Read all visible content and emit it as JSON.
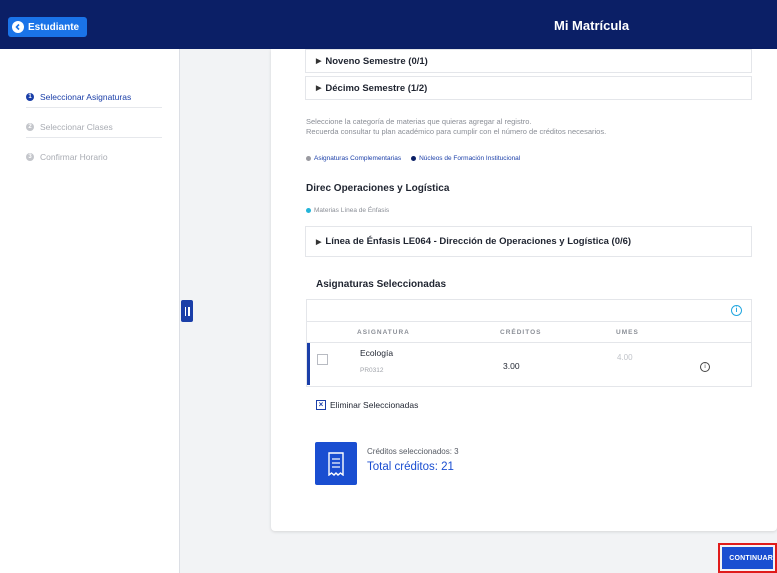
{
  "header": {
    "back_label": "Estudiante",
    "title": "Mi Matrícula",
    "bar_color": "#0b1f66"
  },
  "sidebar": {
    "steps": [
      {
        "label": "Seleccionar Asignaturas",
        "number": "1",
        "state": "active"
      },
      {
        "label": "Seleccionar Clases",
        "number": "2",
        "state": "inactive"
      },
      {
        "label": "Confirmar Horario",
        "number": "3",
        "state": "inactive"
      }
    ]
  },
  "main": {
    "semesters": [
      {
        "label": "Noveno Semestre (0/1)"
      },
      {
        "label": "Décimo Semestre (1/2)"
      }
    ],
    "help_line1": "Seleccione la categoría de materias que quieras agregar al registro.",
    "help_line2": "Recuerda consultar tu plan académico para cumplir con el número de créditos necesarios.",
    "legend": [
      {
        "label": "Asignaturas Complementarias",
        "color": "#9a9aa0"
      },
      {
        "label": "Núcleos de Formación Institucional",
        "color": "#0b1f66"
      }
    ],
    "section_title": "Direc Operaciones y Logística",
    "emphasis_tag": "Materias Línea de Énfasis",
    "emphasis_row": "Línea de Énfasis LE064 - Dirección de Operaciones y Logística (0/6)",
    "selected_title": "Asignaturas Seleccionadas",
    "table": {
      "headers": {
        "asignatura": "ASIGNATURA",
        "creditos": "CRÉDITOS",
        "umes": "UMES"
      },
      "rows": [
        {
          "name": "Ecología",
          "code": "PR0312",
          "credits": "3.00",
          "umes": "4.00"
        }
      ]
    },
    "delete_selected": "Eliminar Seleccionadas",
    "credits_selected": "Créditos seleccionados:  3",
    "total_credits": "Total créditos:  21"
  },
  "footer": {
    "continue_label": "CONTINUAR"
  }
}
